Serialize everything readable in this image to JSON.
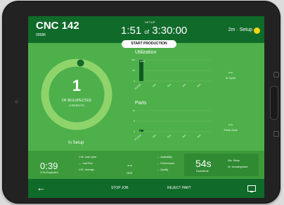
{
  "machine": {
    "name": "CNC 142",
    "code": "00586"
  },
  "header": {
    "phase_label": "SETUP",
    "elapsed": "1:51",
    "of_word": "of",
    "target": "3:30:00",
    "status_text": "2m · Setup",
    "status_color": "#f5d316"
  },
  "start_button": {
    "label": "START PRODUCTION"
  },
  "counter": {
    "count": "1",
    "expected_text": "OF 89 EXPECTED",
    "rejects_text": "0 REJECTS",
    "state_label": "In Setup",
    "progress": 0.02
  },
  "utilization": {
    "title": "Utilization",
    "y_ticks": [
      "100",
      "50",
      "0"
    ],
    "side_label": "In Cycle",
    "side_value": "--",
    "bar_value_label": "100%"
  },
  "parts": {
    "title": "Parts",
    "y_ticks": [
      "10",
      "5",
      "0"
    ],
    "side_label": "Parts Goal",
    "side_value": "--",
    "bar_value_label": "1"
  },
  "chart_data": [
    {
      "type": "bar",
      "title": "Utilization",
      "categories": [
        "10:13pm",
        "1am",
        "2am",
        "3am",
        "4am"
      ],
      "values": [
        100,
        0,
        0,
        0,
        0
      ],
      "ylim": [
        0,
        100
      ]
    },
    {
      "type": "bar",
      "title": "Parts",
      "categories": [
        "10:13pm",
        "1am",
        "2am",
        "3am",
        "4am"
      ],
      "values": [
        1,
        0,
        0,
        0,
        0
      ],
      "ylim": [
        0,
        10
      ]
    }
  ],
  "cycle": {
    "value": "0:39",
    "expected": "2:24 Expected",
    "mini": [
      {
        "value": "1:30",
        "label": "Last Cycle"
      },
      {
        "value": "---",
        "label": "Last Few"
      },
      {
        "value": "1:51",
        "label": "Average"
      }
    ]
  },
  "oee": {
    "value": "--",
    "label": "OEE"
  },
  "oee_parts": [
    {
      "value": "--",
      "label": "Availability"
    },
    {
      "value": "--",
      "label": "Performance"
    },
    {
      "value": "--",
      "label": "Quality"
    }
  ],
  "downtime": {
    "value": "54s",
    "label": "Downtime",
    "items": [
      {
        "value": "54s",
        "label": "Setup"
      },
      {
        "value": "0s",
        "label": "Uncategorized"
      }
    ]
  },
  "footer": {
    "stop_label": "STOP JOB",
    "reject_label": "REJECT PART"
  }
}
